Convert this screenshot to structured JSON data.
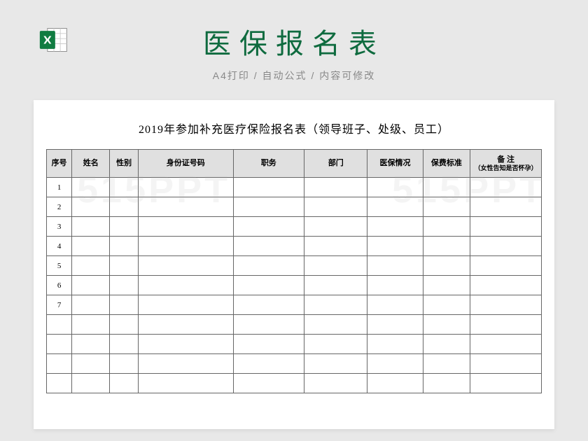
{
  "header": {
    "main_title": "医保报名表",
    "subtitle": "A4打印 / 自动公式 / 内容可修改"
  },
  "sheet": {
    "title": "2019年参加补充医疗保险报名表（领导班子、处级、员工）",
    "columns": [
      "序号",
      "姓名",
      "性别",
      "身份证号码",
      "职务",
      "部门",
      "医保情况",
      "保费标准"
    ],
    "remark_header_main": "备 注",
    "remark_header_sub": "（女性告知是否怀孕）",
    "rows": [
      {
        "seq": "1"
      },
      {
        "seq": "2"
      },
      {
        "seq": "3"
      },
      {
        "seq": "4"
      },
      {
        "seq": "5"
      },
      {
        "seq": "6"
      },
      {
        "seq": "7"
      },
      {
        "seq": ""
      },
      {
        "seq": ""
      },
      {
        "seq": ""
      },
      {
        "seq": ""
      }
    ]
  },
  "watermark": "515PPT",
  "chart_data": {
    "type": "table",
    "title": "2019年参加补充医疗保险报名表（领导班子、处级、员工）",
    "columns": [
      "序号",
      "姓名",
      "性别",
      "身份证号码",
      "职务",
      "部门",
      "医保情况",
      "保费标准",
      "备注（女性告知是否怀孕）"
    ],
    "rows": [
      [
        "1",
        "",
        "",
        "",
        "",
        "",
        "",
        "",
        ""
      ],
      [
        "2",
        "",
        "",
        "",
        "",
        "",
        "",
        "",
        ""
      ],
      [
        "3",
        "",
        "",
        "",
        "",
        "",
        "",
        "",
        ""
      ],
      [
        "4",
        "",
        "",
        "",
        "",
        "",
        "",
        "",
        ""
      ],
      [
        "5",
        "",
        "",
        "",
        "",
        "",
        "",
        "",
        ""
      ],
      [
        "6",
        "",
        "",
        "",
        "",
        "",
        "",
        "",
        ""
      ],
      [
        "7",
        "",
        "",
        "",
        "",
        "",
        "",
        "",
        ""
      ],
      [
        "",
        "",
        "",
        "",
        "",
        "",
        "",
        "",
        ""
      ],
      [
        "",
        "",
        "",
        "",
        "",
        "",
        "",
        "",
        ""
      ],
      [
        "",
        "",
        "",
        "",
        "",
        "",
        "",
        "",
        ""
      ],
      [
        "",
        "",
        "",
        "",
        "",
        "",
        "",
        "",
        ""
      ]
    ]
  }
}
